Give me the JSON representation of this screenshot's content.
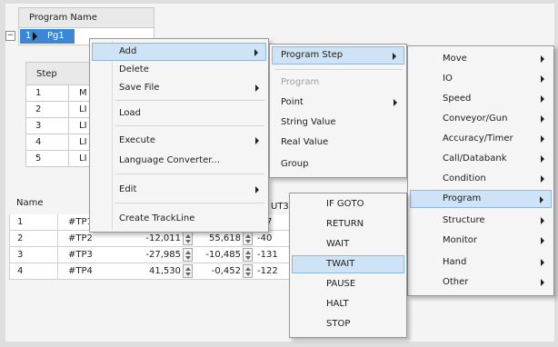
{
  "program_grid": {
    "header": "Program Name",
    "row_number": "1",
    "row_name_partial": "Pg1"
  },
  "step_table": {
    "header": "Step",
    "rows": [
      {
        "num": "1",
        "cut": "M"
      },
      {
        "num": "2",
        "cut": "LI"
      },
      {
        "num": "3",
        "cut": "LI"
      },
      {
        "num": "4",
        "cut": "LI"
      },
      {
        "num": "5",
        "cut": "LI"
      }
    ]
  },
  "name_table": {
    "header": "Name",
    "ut3_header": "UT3",
    "rows": [
      {
        "index": "1",
        "name": "#TP1",
        "v1": "",
        "v2": "",
        "v3": "-27"
      },
      {
        "index": "2",
        "name": "#TP2",
        "v1": "-12,011",
        "v2": "55,618",
        "v3": "-40"
      },
      {
        "index": "3",
        "name": "#TP3",
        "v1": "-27,985",
        "v2": "-10,485",
        "v3": "-131"
      },
      {
        "index": "4",
        "name": "#TP4",
        "v1": "41,530",
        "v2": "-0,452",
        "v3": "-122"
      }
    ]
  },
  "context_menu": {
    "items": [
      {
        "label": "Add",
        "submenu": true,
        "highlighted": true
      },
      {
        "label": "Delete",
        "submenu": false
      },
      {
        "label": "Save File",
        "submenu": true
      },
      {
        "label": "Load",
        "submenu": false
      },
      {
        "label": "Execute",
        "submenu": true
      },
      {
        "label": "Language Converter...",
        "submenu": false
      },
      {
        "label": "Edit",
        "submenu": true
      },
      {
        "label": "Create TrackLine",
        "submenu": false
      }
    ]
  },
  "add_submenu": {
    "items": [
      {
        "label": "Program Step",
        "submenu": true,
        "highlighted": true
      },
      {
        "label": "Program",
        "disabled": true
      },
      {
        "label": "Point",
        "submenu": true
      },
      {
        "label": "String Value"
      },
      {
        "label": "Real Value"
      },
      {
        "label": "Group"
      }
    ]
  },
  "program_step_submenu": {
    "items": [
      {
        "label": "Move"
      },
      {
        "label": "IO"
      },
      {
        "label": "Speed"
      },
      {
        "label": "Conveyor/Gun"
      },
      {
        "label": "Accuracy/Timer"
      },
      {
        "label": "Call/Databank"
      },
      {
        "label": "Condition"
      },
      {
        "label": "Program",
        "highlighted": true
      },
      {
        "label": "Structure"
      },
      {
        "label": "Monitor"
      },
      {
        "label": "Hand"
      },
      {
        "label": "Other"
      }
    ]
  },
  "program_submenu": {
    "items": [
      {
        "label": "IF GOTO"
      },
      {
        "label": "RETURN"
      },
      {
        "label": "WAIT"
      },
      {
        "label": "TWAIT",
        "highlighted": true
      },
      {
        "label": "PAUSE"
      },
      {
        "label": "HALT"
      },
      {
        "label": "STOP"
      }
    ]
  },
  "icons": {
    "expand": "collapse-minus-icon",
    "row_pointer": "row-pointer-icon",
    "submenu_arrow": "submenu-arrow-icon",
    "spin": "spin-button-icon"
  },
  "colors": {
    "selection": "#3b86d6",
    "menu_highlight": "#cfe3f7",
    "menu_background": "#f5f5f5"
  }
}
